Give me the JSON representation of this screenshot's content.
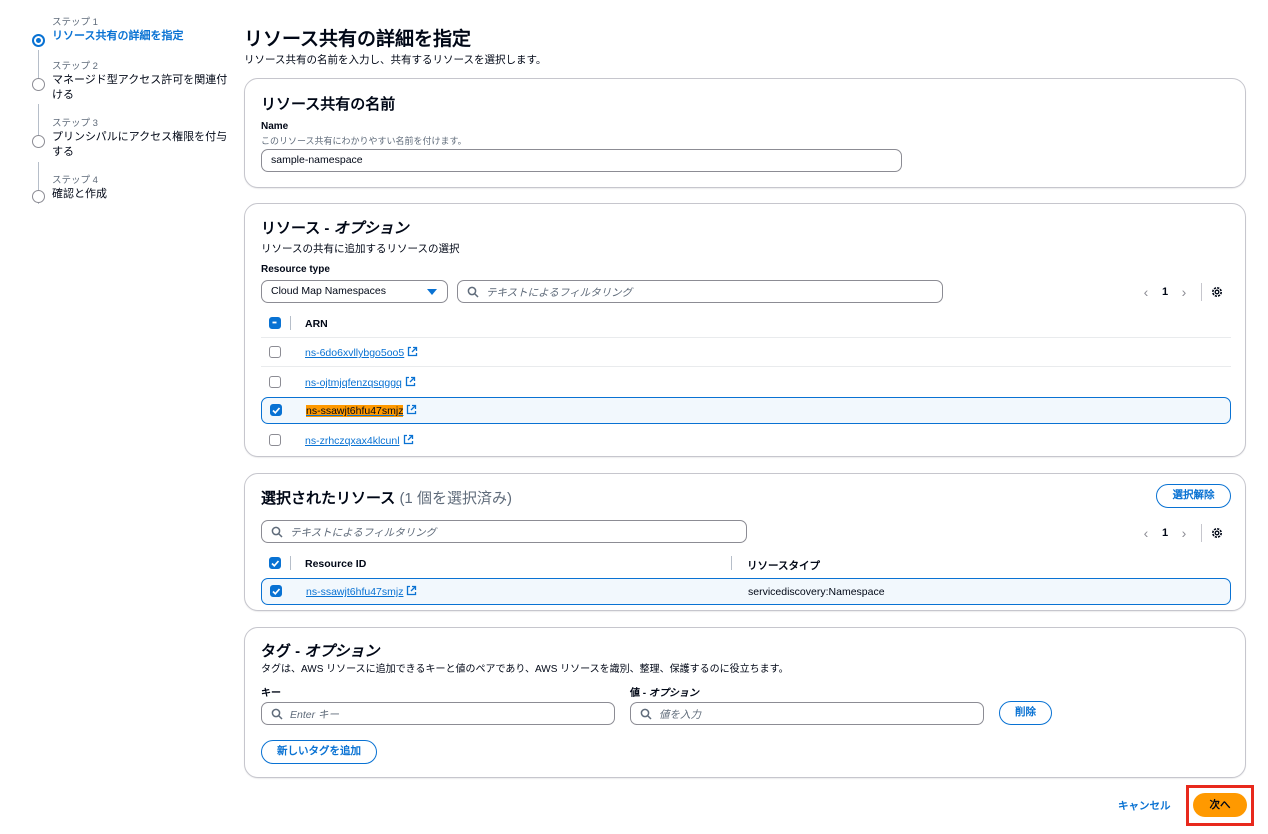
{
  "steps": [
    {
      "sub": "ステップ 1",
      "title": "リソース共有の詳細を指定",
      "active": true
    },
    {
      "sub": "ステップ 2",
      "title": "マネージド型アクセス許可を関連付",
      "title2": "ける"
    },
    {
      "sub": "ステップ 3",
      "title": "プリンシパルにアクセス権限を付与",
      "title2": "する"
    },
    {
      "sub": "ステップ 4",
      "title": "確認と作成"
    }
  ],
  "page": {
    "title": "リソース共有の詳細を指定",
    "description": "リソース共有の名前を入力し、共有するリソースを選択します。"
  },
  "name_panel": {
    "title": "リソース共有の名前",
    "field_label": "Name",
    "field_desc": "このリソース共有にわかりやすい名前を付けます。",
    "value": "sample-namespace"
  },
  "resources_panel": {
    "title_main": "リソース - ",
    "title_opt": "オプション",
    "desc": "リソースの共有に追加するリソースの選択",
    "type_label": "Resource type",
    "type_value": "Cloud Map Namespaces",
    "filter_placeholder": "テキストによるフィルタリング",
    "page": "1",
    "column": "ARN",
    "rows": [
      {
        "arn": "ns-6do6xvllybgo5oo5",
        "checked": false
      },
      {
        "arn": "ns-ojtmjqfenzqsqggq",
        "checked": false
      },
      {
        "arn": "ns-ssawjt6hfu47smjz",
        "checked": true
      },
      {
        "arn": "ns-zrhczqxax4klcunl",
        "checked": false
      }
    ]
  },
  "selected_panel": {
    "title": "選択されたリソース",
    "count_text": "(1 個を選択済み)",
    "deselect_label": "選択解除",
    "filter_placeholder": "テキストによるフィルタリング",
    "page": "1",
    "col_id": "Resource ID",
    "col_type": "リソースタイプ",
    "rows": [
      {
        "id": "ns-ssawjt6hfu47smjz",
        "type": "servicediscovery:Namespace"
      }
    ]
  },
  "tags_panel": {
    "title_main": "タグ - ",
    "title_opt": "オプション",
    "desc": "タグは、AWS リソースに追加できるキーと値のペアであり、AWS リソースを識別、整理、保護するのに役立ちます。",
    "key_label": "キー",
    "value_label_main": "値 - ",
    "value_label_opt": "オプション",
    "key_placeholder": "Enter キー",
    "value_placeholder": "値を入力",
    "remove_label": "削除",
    "add_label": "新しいタグを追加"
  },
  "footer": {
    "cancel_label": "キャンセル",
    "next_label": "次へ"
  },
  "colors": {
    "accent": "#0972d3",
    "primary_button": "#ff9900",
    "annotation_box": "#e8291c"
  }
}
